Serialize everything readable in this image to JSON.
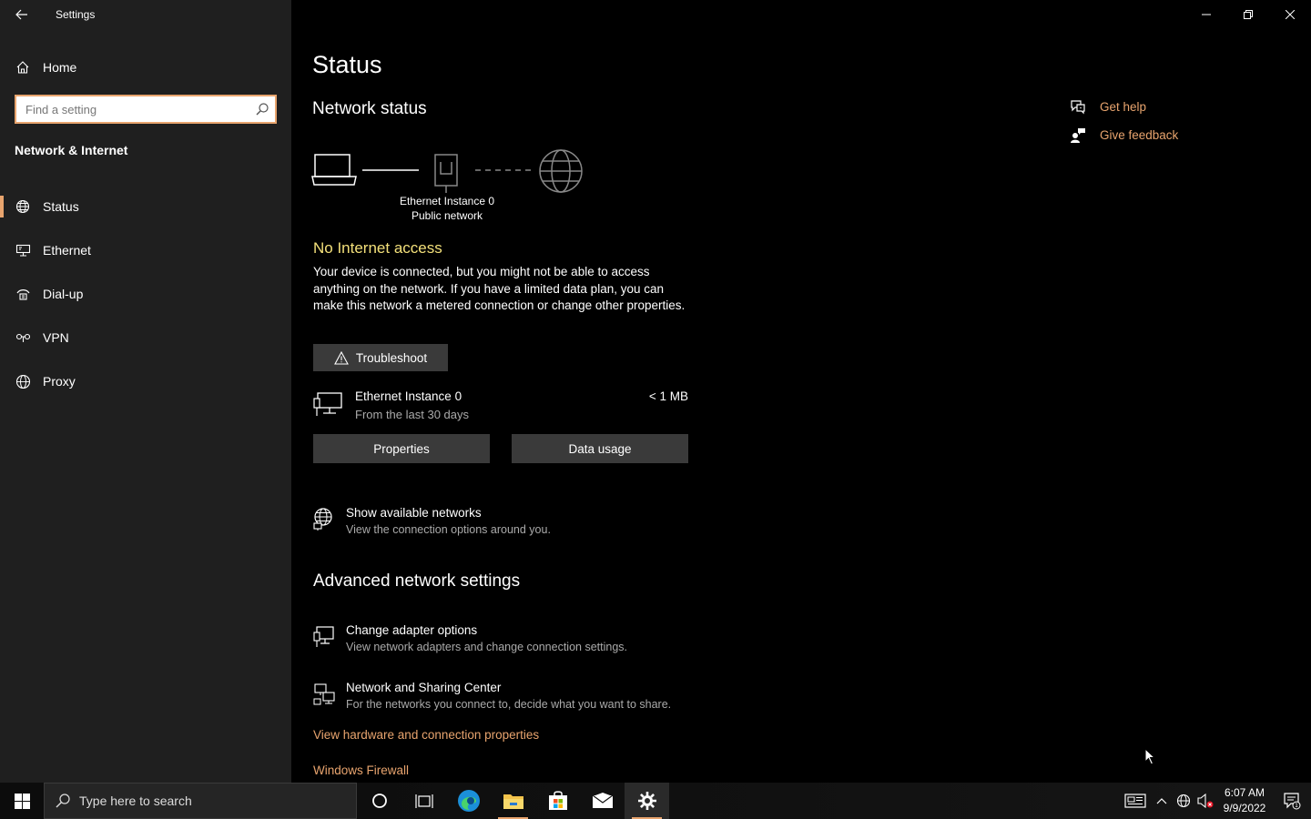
{
  "app": {
    "title": "Settings"
  },
  "sidebar": {
    "home_label": "Home",
    "search_placeholder": "Find a setting",
    "section_title": "Network & Internet",
    "items": [
      {
        "label": "Status",
        "icon": "globe-status-icon",
        "active": true
      },
      {
        "label": "Ethernet",
        "icon": "ethernet-icon",
        "active": false
      },
      {
        "label": "Dial-up",
        "icon": "dialup-icon",
        "active": false
      },
      {
        "label": "VPN",
        "icon": "vpn-icon",
        "active": false
      },
      {
        "label": "Proxy",
        "icon": "globe-icon",
        "active": false
      }
    ]
  },
  "main": {
    "page_title": "Status",
    "network_status_title": "Network status",
    "diagram_label_1": "Ethernet Instance 0",
    "diagram_label_2": "Public network",
    "no_access_title": "No Internet access",
    "description": "Your device is connected, but you might not be able to access anything on the network. If you have a limited data plan, you can make this network a metered connection or change other properties.",
    "troubleshoot_label": "Troubleshoot",
    "adapter": {
      "name": "Ethernet Instance 0",
      "subtitle": "From the last 30 days",
      "usage": "< 1 MB"
    },
    "properties_label": "Properties",
    "data_usage_label": "Data usage",
    "show_networks": {
      "title": "Show available networks",
      "subtitle": "View the connection options around you."
    },
    "advanced_title": "Advanced network settings",
    "change_adapter": {
      "title": "Change adapter options",
      "subtitle": "View network adapters and change connection settings."
    },
    "sharing_center": {
      "title": "Network and Sharing Center",
      "subtitle": "For the networks you connect to, decide what you want to share."
    },
    "hardware_link": "View hardware and connection properties",
    "firewall_link": "Windows Firewall"
  },
  "help": {
    "get_help": "Get help",
    "give_feedback": "Give feedback"
  },
  "taskbar": {
    "search_placeholder": "Type here to search",
    "time": "6:07 AM",
    "date": "9/9/2022",
    "notification_count": "1"
  },
  "colors": {
    "accent": "#e8a46e",
    "warning": "#f3e07a",
    "sidebar_bg": "#1f1f1f"
  }
}
